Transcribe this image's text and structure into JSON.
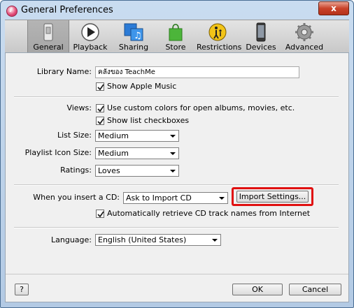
{
  "window": {
    "title": "General Preferences",
    "close_label": "x"
  },
  "toolbar": {
    "items": [
      {
        "label": "General",
        "icon": "general-switch-icon",
        "selected": true
      },
      {
        "label": "Playback",
        "icon": "play-icon",
        "selected": false
      },
      {
        "label": "Sharing",
        "icon": "sharing-music-icon",
        "selected": false
      },
      {
        "label": "Store",
        "icon": "store-bag-icon",
        "selected": false
      },
      {
        "label": "Restrictions",
        "icon": "restrictions-parental-icon",
        "selected": false
      },
      {
        "label": "Devices",
        "icon": "device-phone-icon",
        "selected": false
      },
      {
        "label": "Advanced",
        "icon": "gear-icon",
        "selected": false
      }
    ]
  },
  "general": {
    "library_name_label": "Library Name:",
    "library_name_value": "คลังของ TeachMe",
    "show_apple_music_label": "Show Apple Music",
    "show_apple_music_checked": true,
    "views_label": "Views:",
    "custom_colors_label": "Use custom colors for open albums, movies, etc.",
    "custom_colors_checked": true,
    "show_checkboxes_label": "Show list checkboxes",
    "show_checkboxes_checked": true,
    "list_size_label": "List Size:",
    "list_size_value": "Medium",
    "playlist_icon_size_label": "Playlist Icon Size:",
    "playlist_icon_size_value": "Medium",
    "ratings_label": "Ratings:",
    "ratings_value": "Loves",
    "insert_cd_label": "When you insert a CD:",
    "insert_cd_value": "Ask to Import CD",
    "import_settings_label": "Import Settings...",
    "retrieve_cd_label": "Automatically retrieve CD track names from Internet",
    "retrieve_cd_checked": true,
    "language_label": "Language:",
    "language_value": "English (United States)"
  },
  "footer": {
    "help_label": "?",
    "ok_label": "OK",
    "cancel_label": "Cancel"
  },
  "colors": {
    "highlight": "#e01010",
    "window_frame": "#b3cae4"
  }
}
